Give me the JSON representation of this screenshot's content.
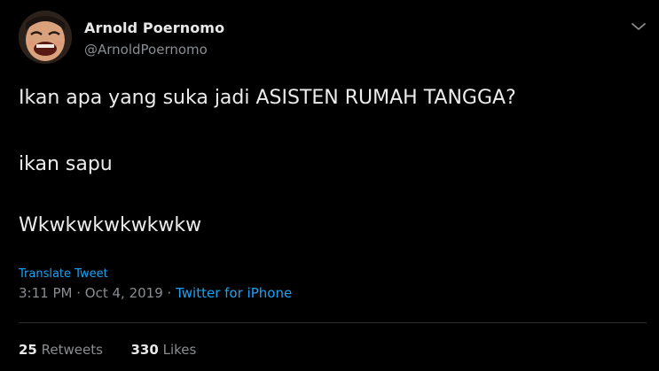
{
  "user": {
    "display_name": "Arnold Poernomo",
    "handle": "@ArnoldPoernomo"
  },
  "tweet": {
    "lines": [
      "Ikan apa yang suka jadi ASISTEN RUMAH TANGGA?",
      "ikan sapu",
      "Wkwkwkwkwkwkw"
    ],
    "translate_label": "Translate Tweet",
    "time": "3:11 PM",
    "date": "Oct 4, 2019",
    "separator": "·",
    "source": "Twitter for iPhone"
  },
  "stats": {
    "retweets_count": "25",
    "retweets_label": "Retweets",
    "likes_count": "330",
    "likes_label": "Likes"
  },
  "icons": {
    "menu": "chevron-down-icon"
  },
  "colors": {
    "background": "#000000",
    "accent": "#1da1f2",
    "secondary_text": "#8a8d91"
  }
}
